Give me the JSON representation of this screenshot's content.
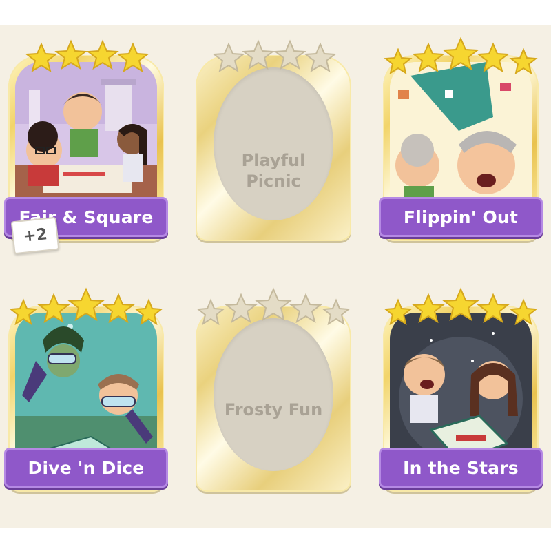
{
  "cards": [
    {
      "title": "Fair & Square",
      "stars": 4,
      "collected": true,
      "extra_badge": "+2"
    },
    {
      "title": "Playful Picnic",
      "stars": 4,
      "collected": false
    },
    {
      "title": "Flippin' Out",
      "stars": 5,
      "collected": true
    },
    {
      "title": "Dive 'n Dice",
      "stars": 5,
      "collected": true
    },
    {
      "title": "Frosty Fun",
      "stars": 5,
      "collected": false
    },
    {
      "title": "In the Stars",
      "stars": 5,
      "collected": true
    }
  ],
  "colors": {
    "ribbon": "#8f58c9",
    "star_gold": "#f6d630",
    "star_locked": "#e4dcc6",
    "background": "#f5f0e4"
  },
  "icons": [
    "star-icon",
    "plus-badge"
  ]
}
